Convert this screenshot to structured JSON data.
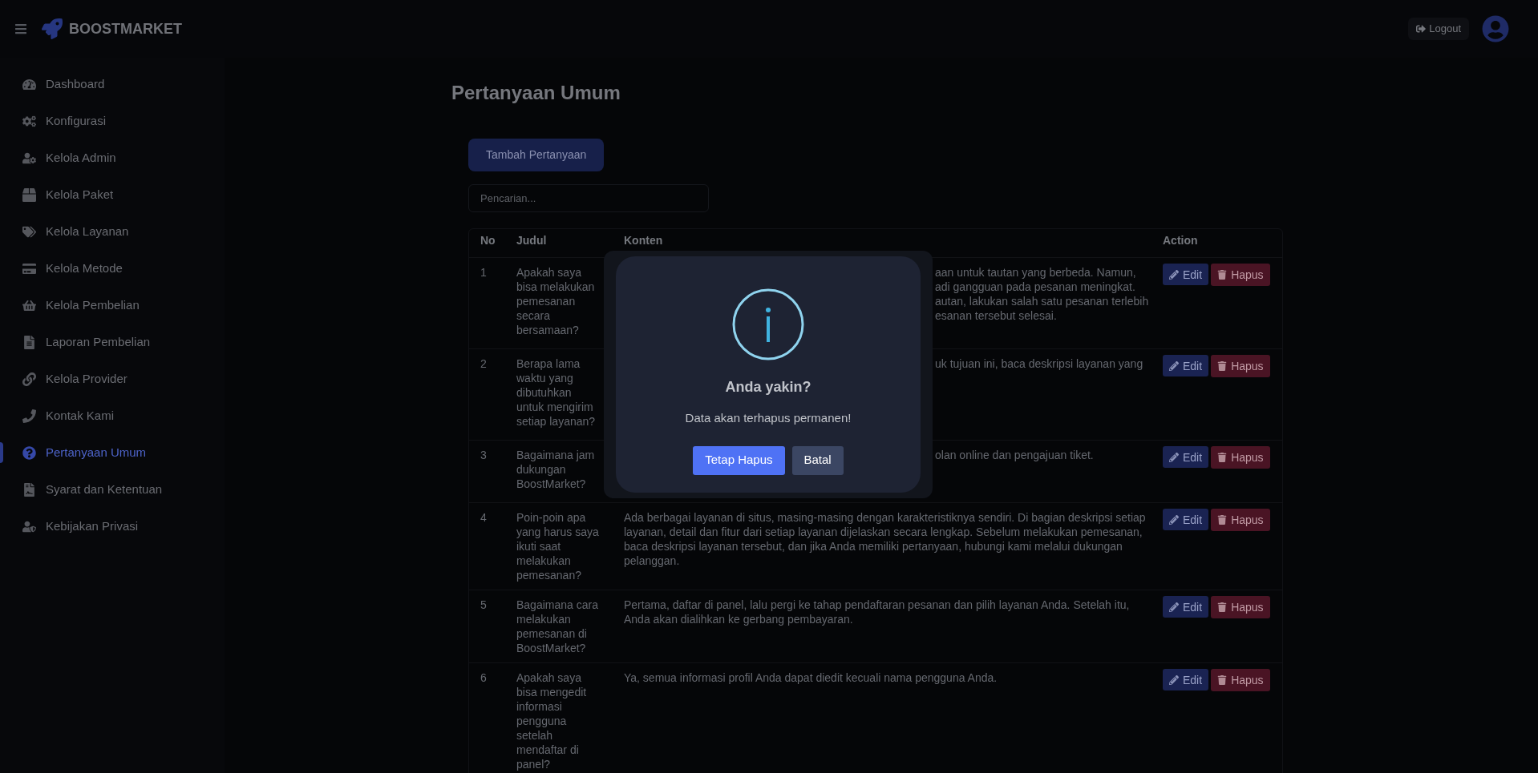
{
  "header": {
    "brand": "BOOSTMARKET",
    "logout": "Logout"
  },
  "sidebar": {
    "items": [
      {
        "label": "Dashboard",
        "selected": false
      },
      {
        "label": "Konfigurasi",
        "selected": false
      },
      {
        "label": "Kelola Admin",
        "selected": false
      },
      {
        "label": "Kelola Paket",
        "selected": false
      },
      {
        "label": "Kelola Layanan",
        "selected": false
      },
      {
        "label": "Kelola Metode",
        "selected": false
      },
      {
        "label": "Kelola Pembelian",
        "selected": false
      },
      {
        "label": "Laporan Pembelian",
        "selected": false
      },
      {
        "label": "Kelola Provider",
        "selected": false
      },
      {
        "label": "Kontak Kami",
        "selected": false
      },
      {
        "label": "Pertanyaan Umum",
        "selected": true
      },
      {
        "label": "Syarat dan Ketentuan",
        "selected": false
      },
      {
        "label": "Kebijakan Privasi",
        "selected": false
      }
    ]
  },
  "page": {
    "title": "Pertanyaan Umum",
    "add_button": "Tambah Pertanyaan",
    "search": {
      "placeholder": "Pencarian..."
    }
  },
  "table": {
    "columns": [
      "No",
      "Judul",
      "Konten",
      "Action"
    ],
    "rows": [
      {
        "no": "1",
        "judul": "Apakah saya bisa melakukan pemesanan secara bersamaan?",
        "kind": "covered",
        "konten": [
          "aan untuk tautan yang berbeda. Namun,",
          "adi gangguan pada pesanan meningkat.",
          "autan, lakukan salah satu pesanan terlebih",
          "esanan tersebut selesai."
        ],
        "edit": "Edit",
        "hapus": "Hapus"
      },
      {
        "no": "2",
        "judul": "Berapa lama waktu yang dibutuhkan untuk mengirim setiap layanan?",
        "kind": "covered",
        "konten": [
          "uk tujuan ini, baca deskripsi layanan yang"
        ],
        "edit": "Edit",
        "hapus": "Hapus"
      },
      {
        "no": "3",
        "judul": "Bagaimana jam dukungan BoostMarket?",
        "kind": "covered",
        "konten": [
          "olan online dan pengajuan tiket."
        ],
        "edit": "Edit",
        "hapus": "Hapus"
      },
      {
        "no": "4",
        "judul": "Poin-poin apa yang harus saya ikuti saat melakukan pemesanan?",
        "kind": "full",
        "konten": [
          "Ada berbagai layanan di situs, masing-masing dengan karakteristiknya sendiri. Di bagian deskripsi setiap layanan, detail dan fitur dari setiap layanan dijelaskan secara lengkap. Sebelum melakukan pemesanan, baca deskripsi layanan tersebut, dan jika Anda memiliki pertanyaan, hubungi kami melalui dukungan pelanggan."
        ],
        "edit": "Edit",
        "hapus": "Hapus"
      },
      {
        "no": "5",
        "judul": "Bagaimana cara melakukan pemesanan di BoostMarket?",
        "kind": "full",
        "konten": [
          "Pertama, daftar di panel, lalu pergi ke tahap pendaftaran pesanan dan pilih layanan Anda. Setelah itu, Anda akan dialihkan ke gerbang pembayaran."
        ],
        "edit": "Edit",
        "hapus": "Hapus"
      },
      {
        "no": "6",
        "judul": "Apakah saya bisa mengedit informasi pengguna setelah mendaftar di panel?",
        "kind": "full",
        "konten": [
          "Ya, semua informasi profil Anda dapat diedit kecuali nama pengguna Anda."
        ],
        "edit": "Edit",
        "hapus": "Hapus"
      }
    ]
  },
  "dialog": {
    "title": "Anda yakin?",
    "message": "Data akan terhapus permanen!",
    "confirm": "Tetap Hapus",
    "cancel": "Batal"
  }
}
